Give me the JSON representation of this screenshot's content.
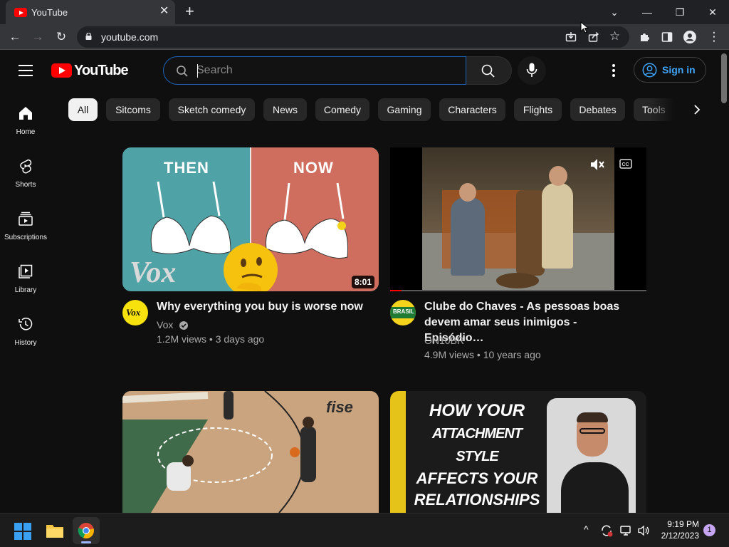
{
  "browser": {
    "tab_title": "YouTube",
    "url": "youtube.com"
  },
  "header": {
    "logo_text": "YouTube",
    "search_placeholder": "Search",
    "signin_label": "Sign in"
  },
  "sidebar": {
    "items": [
      {
        "label": "Home",
        "icon": "home-icon"
      },
      {
        "label": "Shorts",
        "icon": "shorts-icon"
      },
      {
        "label": "Subscriptions",
        "icon": "subscriptions-icon"
      },
      {
        "label": "Library",
        "icon": "library-icon"
      },
      {
        "label": "History",
        "icon": "history-icon"
      }
    ]
  },
  "chips": [
    "All",
    "Sitcoms",
    "Sketch comedy",
    "News",
    "Comedy",
    "Gaming",
    "Characters",
    "Flights",
    "Debates",
    "Tools"
  ],
  "videos": [
    {
      "thumb_left_label": "THEN",
      "thumb_right_label": "NOW",
      "thumb_brand": "Vox",
      "duration": "8:01",
      "avatar_text": "Vox",
      "title": "Why everything you buy is worse now",
      "channel": "Vox",
      "verified": true,
      "views": "1.2M views",
      "age": "3 days ago"
    },
    {
      "title_line1": "Clube do Chaves - As pessoas boas",
      "title_line2": "devem amar seus inimigos - Episódio…",
      "channel": "ON10BR",
      "views": "4.9M views",
      "age": "10 years ago",
      "avatar_text": "BRASIL",
      "progress_fraction": 0.045
    },
    {
      "thumb_brand": "fise"
    },
    {
      "thumb_line1": "HOW YOUR",
      "thumb_line2": "ATTACHMENT STYLE",
      "thumb_line3": "AFFECTS YOUR",
      "thumb_line4": "RELATIONSHIPS"
    }
  ],
  "taskbar": {
    "time": "9:19 PM",
    "date": "2/12/2023",
    "notification_count": "1"
  },
  "colors": {
    "accent_blue": "#3ea6ff",
    "youtube_red": "#ff0000",
    "background": "#0f0f0f",
    "chip_bg": "#272727"
  }
}
